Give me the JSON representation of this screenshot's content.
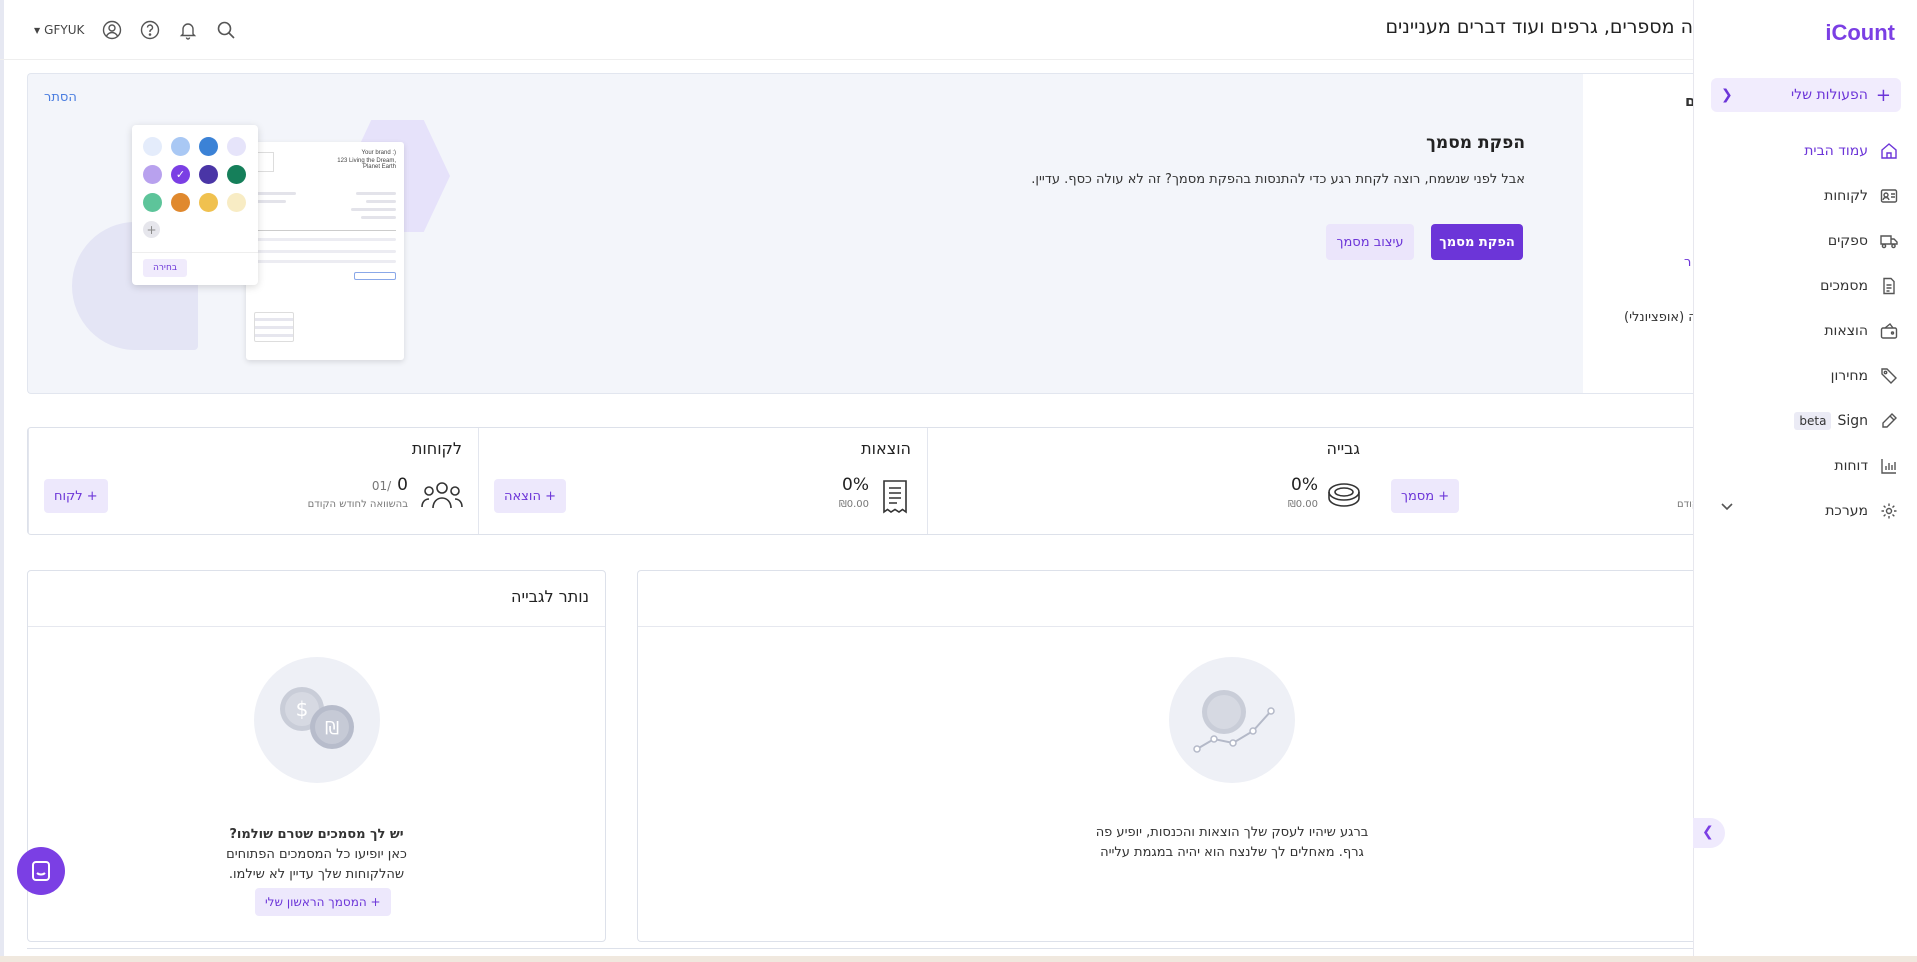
{
  "app": {
    "logo": "iCount",
    "user": "GFYUK"
  },
  "header": {
    "title": "ה מספרים, גרפים ועוד דברים מעניינים"
  },
  "sidebar": {
    "my_actions": "הפעולות שלי",
    "items": [
      {
        "label": "עמוד הבית",
        "icon": "home-icon"
      },
      {
        "label": "לקוחות",
        "icon": "contact-card-icon"
      },
      {
        "label": "ספקים",
        "icon": "truck-icon"
      },
      {
        "label": "מסמכים",
        "icon": "document-icon"
      },
      {
        "label": "הוצאות",
        "icon": "wallet-icon"
      },
      {
        "label": "מחירון",
        "icon": "tag-icon"
      },
      {
        "label": "Sign",
        "icon": "pen-icon",
        "badge": "beta"
      },
      {
        "label": "דוחות",
        "icon": "bar-chart-icon"
      },
      {
        "label": "מערכת",
        "icon": "gear-icon"
      }
    ]
  },
  "promo": {
    "hide": "הסתר",
    "title": "הפקת מסמך",
    "text": "אבל לפני שנשמח, רוצה לקחת רגע כדי להתנסות בהפקת מסמך? זה לא עולה כסף. עדיין.",
    "primary_button": "הפקת מסמך",
    "secondary_button": "עיצוב מסמך",
    "partial_title": "ם",
    "partial_link": "ר",
    "partial_optional": "ה (אופציונלי)",
    "palette_button": "בחירה",
    "doc_brand": "Your brand :)",
    "doc_address": "123 Living the Dream, Planet Earth"
  },
  "stats": {
    "customers": {
      "title": "לקוחות",
      "value": "0",
      "compare": "01/",
      "sub": "בהשוואה לחודש הקודם",
      "button": "+ לקוח"
    },
    "expenses": {
      "title": "הוצאות",
      "value": "0%",
      "amount": "₪0.00",
      "button": "+ הוצאה"
    },
    "collection": {
      "title": "גבייה",
      "value": "0%",
      "amount": "₪0.00"
    },
    "documents": {
      "button": "+ מסמך",
      "sub": "קודם"
    }
  },
  "cards": {
    "remaining": {
      "title": "נותר לגבייה",
      "bold": "יש לך מסמכים שטרם שולמו?",
      "line1": "כאן יופיעו כל המסמכים הפתוחים",
      "line2": "שהלקוחות שלך עדיין לא שילמו.",
      "button": "+ המסמך הראשון שלי"
    },
    "graph": {
      "line1": "ברגע שיהיו לעסק שלך הוצאות והכנסות, יופיע פה",
      "line2": "גרף. מאחלים לך שלנצח הוא יהיה במגמת עלייה"
    }
  },
  "colors": {
    "accent": "#6c35d8",
    "brand": "#7b3fe4"
  }
}
